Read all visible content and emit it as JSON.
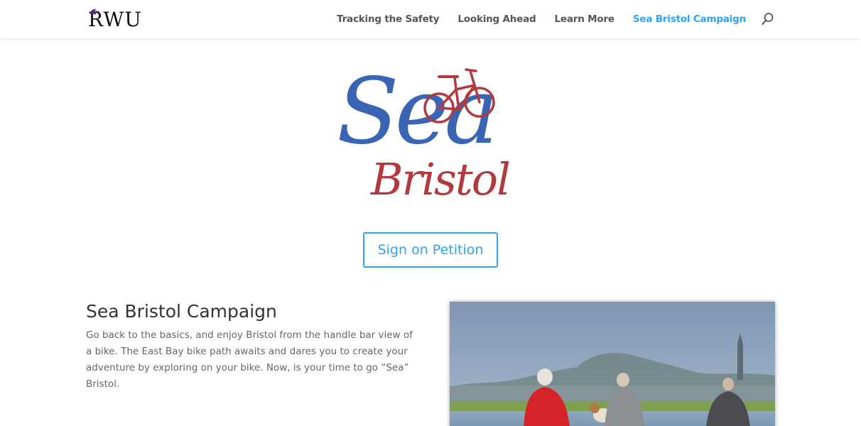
{
  "header": {
    "logo_text": "RWU",
    "nav": [
      {
        "label": "Tracking the Safety"
      },
      {
        "label": "Looking Ahead"
      },
      {
        "label": "Learn More"
      },
      {
        "label": "Sea Bristol Campaign",
        "active": true
      }
    ],
    "active_color": "#2ea3f2"
  },
  "hero": {
    "logo_word1": "Sea",
    "logo_word2": "Bristol",
    "word1_color": "#3a64b4",
    "word2_color": "#b23a3e"
  },
  "petition_button": {
    "label": "Sign on Petition"
  },
  "content": {
    "title": "Sea Bristol Campaign",
    "body": "Go back to the basics, and enjoy Bristol from the handle bar view of a bike. The East Bay bike path awaits and dares you to create your adventure by exploring on your bike. Now, is your time to go “Sea” Bristol."
  }
}
